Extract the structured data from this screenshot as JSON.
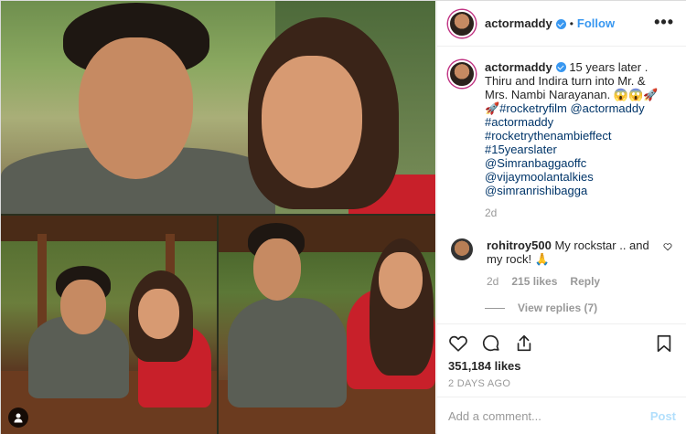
{
  "header": {
    "username": "actormaddy",
    "dot": "•",
    "follow_label": "Follow",
    "more_label": "•••"
  },
  "caption": {
    "username": "actormaddy",
    "text": "15 years later . Thiru and Indira turn into Mr. & Mrs. Nambi Narayanan. 😱😱🚀",
    "tags": [
      "🚀#rocketryfilm @actormaddy",
      "#actormaddy",
      "#rocketrythenambieffect",
      "#15yearslater",
      "@Simranbaggaoffc",
      "@vijaymoolantalkies",
      "@simranrishibagga"
    ],
    "time": "2d"
  },
  "comment": {
    "username": "rohitroy500",
    "text": "My rockstar .. and my rock! 🙏",
    "time": "2d",
    "likes": "215 likes",
    "reply_label": "Reply",
    "view_replies": "View replies (7)"
  },
  "actions": {
    "likes": "351,184 likes",
    "date": "2 DAYS AGO"
  },
  "add_comment": {
    "placeholder": "Add a comment...",
    "post_label": "Post"
  },
  "colors": {
    "accent": "#3897f0",
    "link": "#003569",
    "muted": "#999999",
    "post_disabled": "#b2dffc"
  },
  "icons": [
    "heart-icon",
    "comment-icon",
    "share-icon",
    "bookmark-icon",
    "more-icon",
    "verified-icon",
    "user-tag-icon"
  ]
}
